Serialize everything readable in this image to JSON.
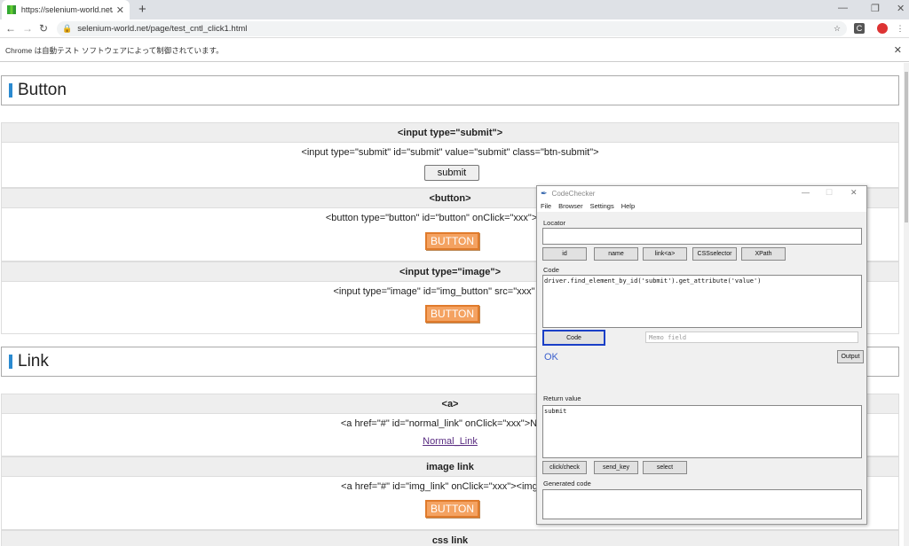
{
  "browser": {
    "tab_title": "https://selenium-world.net/page/",
    "url": "selenium-world.net/page/test_cntl_click1.html",
    "infobar_text": "Chrome は自動テスト ソフトウェアによって制御されています。"
  },
  "page": {
    "sections": {
      "button": {
        "title": "Button",
        "rows": [
          {
            "head": "<input type=\"submit\">",
            "code": "<input type=\"submit\" id=\"submit\" value=\"submit\" class=\"btn-submit\">",
            "control": "submit"
          },
          {
            "head": "<button>",
            "code": "<button type=\"button\" id=\"button\" onClick=\"xxx\"><img src",
            "control": "BUTTON"
          },
          {
            "head": "<input type=\"image\">",
            "code": "<input type=\"image\" id=\"img_button\" src=\"xxx\" alt=\"xx",
            "control": "BUTTON"
          }
        ]
      },
      "link": {
        "title": "Link",
        "rows": [
          {
            "head": "<a>",
            "code": "<a href=\"#\" id=\"normal_link\" onClick=\"xxx\">Norma",
            "control": "Normal_Link"
          },
          {
            "head": "image link",
            "code": "<a href=\"#\" id=\"img_link\" onClick=\"xxx\"><img src=",
            "control": "BUTTON"
          },
          {
            "head": "css link"
          }
        ]
      }
    }
  },
  "codechecker": {
    "title": "CodeChecker",
    "menu": [
      "File",
      "Browser",
      "Settings",
      "Help"
    ],
    "locator_label": "Locator",
    "locator_value": "",
    "locator_buttons": [
      "id",
      "name",
      "link<a>",
      "CSSselector",
      "XPath"
    ],
    "code_label": "Code",
    "code_value": "driver.find_element_by_id('submit').get_attribute('value')",
    "code_button": "Code",
    "memo_placeholder": "Memo field",
    "status": "OK",
    "output_button": "Output",
    "return_label": "Return value",
    "return_value": "submit",
    "action_buttons": [
      "click/check",
      "send_key",
      "select"
    ],
    "generated_label": "Generated code",
    "generated_value": ""
  }
}
